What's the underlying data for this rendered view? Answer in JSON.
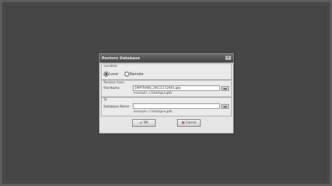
{
  "dialog": {
    "title": "Restore Database",
    "close_glyph": "▾"
  },
  "location": {
    "group_label": "Location",
    "options": [
      {
        "label": "Local",
        "selected": true
      },
      {
        "label": "Remote",
        "selected": false
      }
    ]
  },
  "restore_from": {
    "group_label": "Restore from",
    "file_label": "File Name",
    "file_value": "EMPTRANS_29C31112905.gbk",
    "example": "example: c:\\data\\gsa.gbk"
  },
  "to": {
    "group_label": "To",
    "db_label": "Database Name",
    "db_value": "",
    "example": "example: c:\\data\\gsa.gdb"
  },
  "buttons": {
    "ok_label": "OK",
    "cancel_label": "Cancel",
    "ok_icon": "check-icon",
    "cancel_icon": "x-icon"
  },
  "colors": {
    "desktop": "#484848",
    "titlebar": "#505050",
    "dialog": "#e6e6e6"
  }
}
